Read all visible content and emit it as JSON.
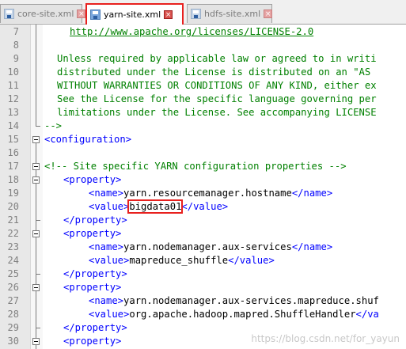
{
  "tabs": [
    {
      "label": "core-site.xml",
      "close": "×"
    },
    {
      "label": "yarn-site.xml",
      "close": "×"
    },
    {
      "label": "hdfs-site.xml",
      "close": "×"
    }
  ],
  "lines": [
    {
      "n": "7",
      "text": "    http://www.apache.org/licenses/LICENSE-2.0"
    },
    {
      "n": "8",
      "text": ""
    },
    {
      "n": "9",
      "text": "  Unless required by applicable law or agreed to in writi"
    },
    {
      "n": "10",
      "text": "  distributed under the License is distributed on an \"AS"
    },
    {
      "n": "11",
      "text": "  WITHOUT WARRANTIES OR CONDITIONS OF ANY KIND, either ex"
    },
    {
      "n": "12",
      "text": "  See the License for the specific language governing per"
    },
    {
      "n": "13",
      "text": "  limitations under the License. See accompanying LICENSE"
    },
    {
      "n": "14",
      "text": "-->"
    },
    {
      "n": "15",
      "text": "<configuration>"
    },
    {
      "n": "16",
      "text": ""
    },
    {
      "n": "17",
      "text": "<!-- Site specific YARN configuration properties -->"
    },
    {
      "n": "18",
      "text": "<property>"
    },
    {
      "n": "19",
      "text": "<name>yarn.resourcemanager.hostname</name>"
    },
    {
      "n": "20",
      "text": "<value>bigdata01</value>"
    },
    {
      "n": "21",
      "text": "</property>"
    },
    {
      "n": "22",
      "text": "<property>"
    },
    {
      "n": "23",
      "text": "<name>yarn.nodemanager.aux-services</name>"
    },
    {
      "n": "24",
      "text": "<value>mapreduce_shuffle</value>"
    },
    {
      "n": "25",
      "text": "</property>"
    },
    {
      "n": "26",
      "text": "<property>"
    },
    {
      "n": "27",
      "text": "<name>yarn.nodemanager.aux-services.mapreduce.shuf"
    },
    {
      "n": "28",
      "text": "<value>org.apache.hadoop.mapred.ShuffleHandler</va"
    },
    {
      "n": "29",
      "text": "</property>"
    },
    {
      "n": "30",
      "text": "<property>"
    }
  ],
  "code": {
    "license_url": "http://www.apache.org/licenses/LICENSE-2.0",
    "l9": "Unless required by applicable law or agreed to in writi",
    "l10": "distributed under the License is distributed on an \"AS",
    "l11": "WITHOUT WARRANTIES OR CONDITIONS OF ANY KIND, either ex",
    "l12": "See the License for the specific language governing per",
    "l13": "limitations under the License. See accompanying LICENSE",
    "comment_end": "-->",
    "config_open": "<configuration>",
    "yarn_comment": "<!-- Site specific YARN configuration properties -->",
    "prop_open": "<property>",
    "prop_close": "</property>",
    "name_open": "<name>",
    "name_close": "</name>",
    "value_open": "<value>",
    "value_close": "</value>",
    "name1": "yarn.resourcemanager.hostname",
    "value1": "bigdata01",
    "name2": "yarn.nodemanager.aux-services",
    "value2": "mapreduce_shuffle",
    "name3": "yarn.nodemanager.aux-services.mapreduce.shuf",
    "value3": "org.apache.hadoop.mapred.ShuffleHandler",
    "value3_close": "</va"
  },
  "watermark": "https://blog.csdn.net/for_yayun",
  "colors": {
    "tag": "#0000ff",
    "comment": "#008000",
    "highlight": "#e8201e"
  }
}
